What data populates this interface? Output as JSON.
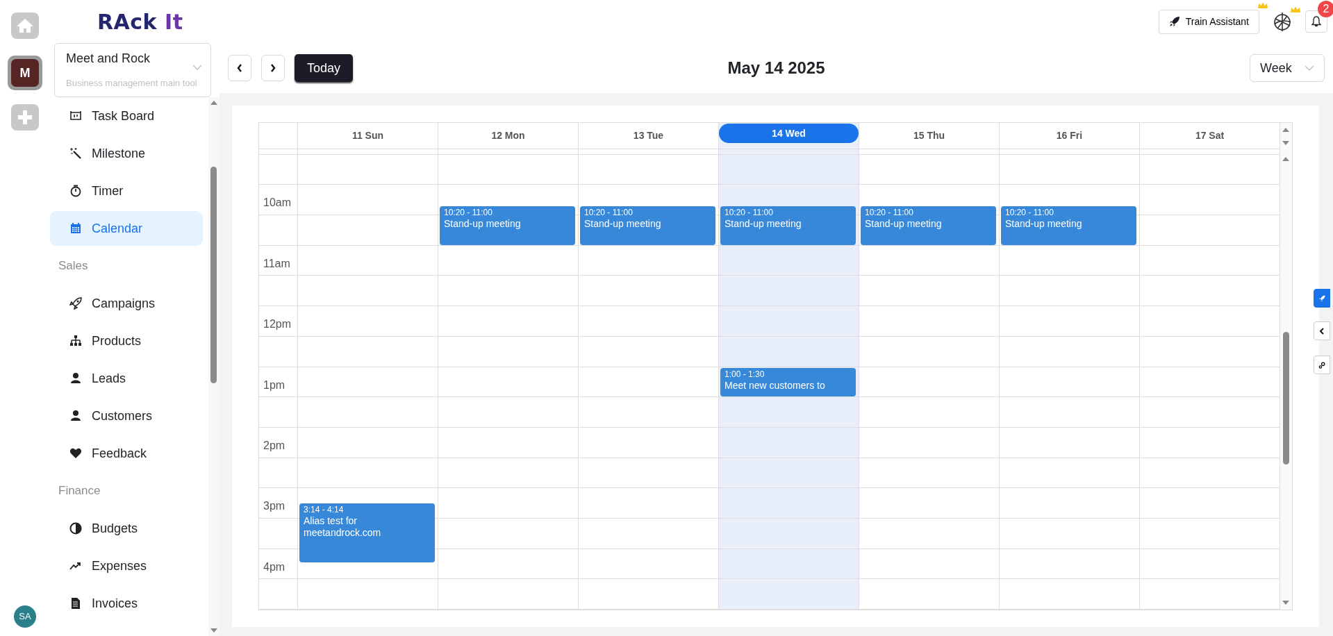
{
  "rail": {
    "workspace": "M",
    "user": "SA"
  },
  "logo": {
    "main": "RAck",
    "accent": "It"
  },
  "org": {
    "name": "Meet and Rock",
    "subtitle": "Business management main tool"
  },
  "sidebar": {
    "items": [
      {
        "kind": "item",
        "label": "Task Board",
        "selected": false
      },
      {
        "kind": "item",
        "label": "Milestone",
        "selected": false
      },
      {
        "kind": "item",
        "label": "Timer",
        "selected": false
      },
      {
        "kind": "item",
        "label": "Calendar",
        "selected": true
      },
      {
        "kind": "section",
        "label": "Sales"
      },
      {
        "kind": "item",
        "label": "Campaigns",
        "selected": false
      },
      {
        "kind": "item",
        "label": "Products",
        "selected": false
      },
      {
        "kind": "item",
        "label": "Leads",
        "selected": false
      },
      {
        "kind": "item",
        "label": "Customers",
        "selected": false
      },
      {
        "kind": "item",
        "label": "Feedback",
        "selected": false
      },
      {
        "kind": "section",
        "label": "Finance"
      },
      {
        "kind": "item",
        "label": "Budgets",
        "selected": false
      },
      {
        "kind": "item",
        "label": "Expenses",
        "selected": false
      },
      {
        "kind": "item",
        "label": "Invoices",
        "selected": false
      }
    ]
  },
  "topbar": {
    "train_button": "Train Assistant",
    "notification_count": "2"
  },
  "toolbar": {
    "today_button": "Today",
    "title": "May 14 2025",
    "view": "Week"
  },
  "calendar": {
    "time_labels": [
      "10am",
      "11am",
      "12pm",
      "1pm",
      "2pm",
      "3pm",
      "4pm"
    ],
    "days": [
      {
        "label": "11 Sun",
        "today": false,
        "events": [
          {
            "time": "3:14 - 4:14",
            "title": "Alias test for meetandrock.com"
          }
        ]
      },
      {
        "label": "12 Mon",
        "today": false,
        "events": [
          {
            "time": "10:20 - 11:00",
            "title": "Stand-up meeting"
          }
        ]
      },
      {
        "label": "13 Tue",
        "today": false,
        "events": [
          {
            "time": "10:20 - 11:00",
            "title": "Stand-up meeting"
          }
        ]
      },
      {
        "label": "14 Wed",
        "today": true,
        "events": [
          {
            "time": "10:20 - 11:00",
            "title": "Stand-up meeting"
          },
          {
            "time": "1:00 - 1:30",
            "title": "Meet new customers to"
          }
        ]
      },
      {
        "label": "15 Thu",
        "today": false,
        "events": [
          {
            "time": "10:20 - 11:00",
            "title": "Stand-up meeting"
          }
        ]
      },
      {
        "label": "16 Fri",
        "today": false,
        "events": [
          {
            "time": "10:20 - 11:00",
            "title": "Stand-up meeting"
          }
        ]
      },
      {
        "label": "17 Sat",
        "today": false
      }
    ]
  }
}
